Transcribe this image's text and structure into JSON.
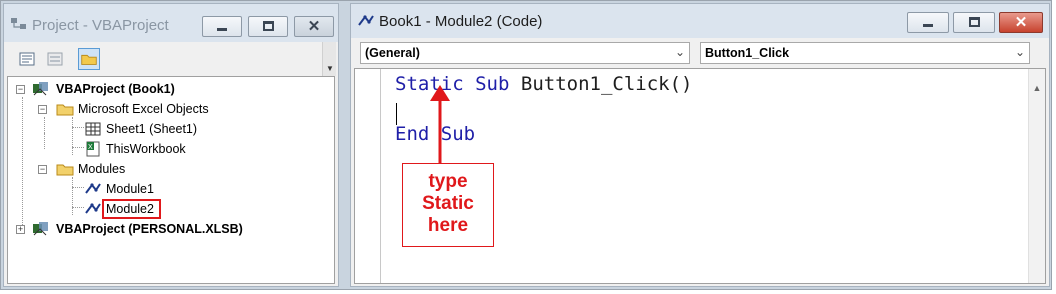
{
  "project_window": {
    "title": "Project - VBAProject",
    "tree": {
      "root1": "VBAProject (Book1)",
      "folder1": "Microsoft Excel Objects",
      "sheet1": "Sheet1 (Sheet1)",
      "thisworkbook": "ThisWorkbook",
      "folder2": "Modules",
      "module1": "Module1",
      "module2": "Module2",
      "root2": "VBAProject (PERSONAL.XLSB)"
    }
  },
  "code_window": {
    "title": "Book1 - Module2 (Code)",
    "object_combo": "(General)",
    "procedure_combo": "Button1_Click",
    "code": {
      "kw_static": "Static",
      "kw_sub": "Sub",
      "proc_sig": "Button1_Click()",
      "kw_end": "End",
      "kw_sub2": "Sub"
    }
  },
  "annotation": {
    "line1": "type",
    "line2": "Static",
    "line3": "here",
    "color": "#e0181b"
  },
  "colors": {
    "keyword": "#1f1fa8",
    "highlight": "#e0181b"
  }
}
